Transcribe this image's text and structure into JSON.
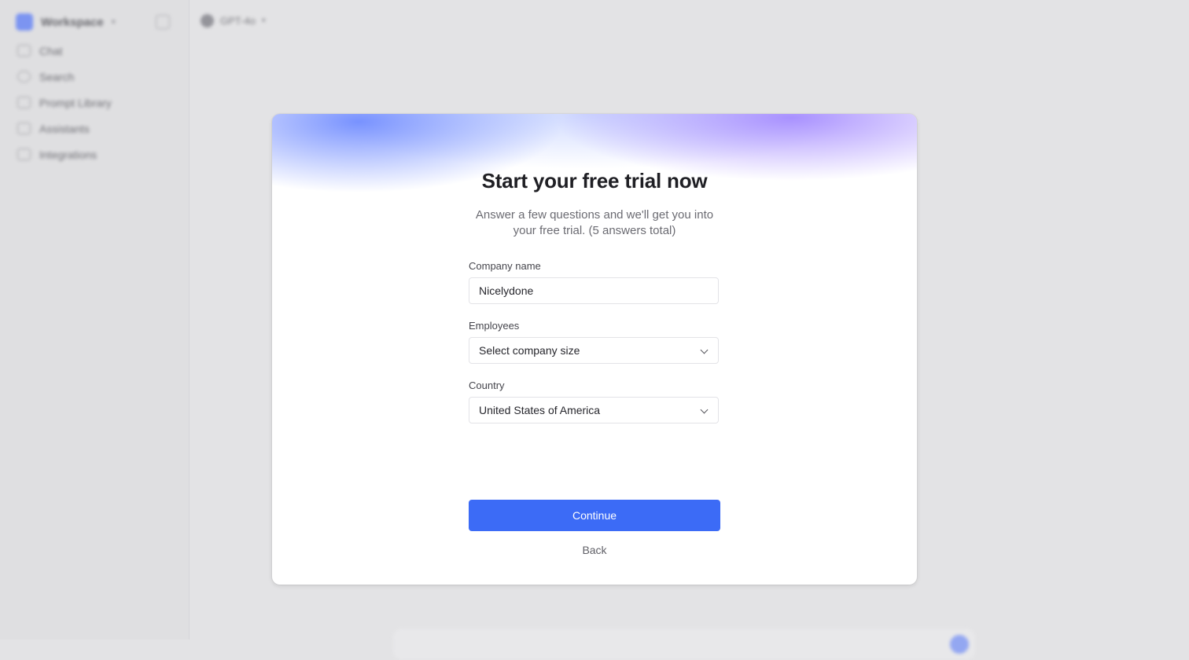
{
  "sidebar": {
    "workspace_name": "Workspace",
    "items": [
      {
        "label": "Chat",
        "icon": "chat-icon"
      },
      {
        "label": "Search",
        "icon": "search-icon"
      },
      {
        "label": "Prompt Library",
        "icon": "library-icon"
      },
      {
        "label": "Assistants",
        "icon": "assistant-icon"
      },
      {
        "label": "Integrations",
        "icon": "integrations-icon"
      }
    ]
  },
  "topbar": {
    "model_label": "GPT-4o"
  },
  "modal": {
    "title": "Start your free trial now",
    "subtitle": "Answer a few questions and we'll get you into your free trial. (5 answers total)",
    "fields": {
      "company_name": {
        "label": "Company name",
        "value": "Nicelydone"
      },
      "employees": {
        "label": "Employees",
        "value": "Select company size"
      },
      "country": {
        "label": "Country",
        "value": "United States of America"
      }
    },
    "continue_label": "Continue",
    "back_label": "Back"
  },
  "colors": {
    "accent": "#3c6bf6",
    "title": "#1f1f24",
    "backdrop": "#e3e3e5"
  }
}
